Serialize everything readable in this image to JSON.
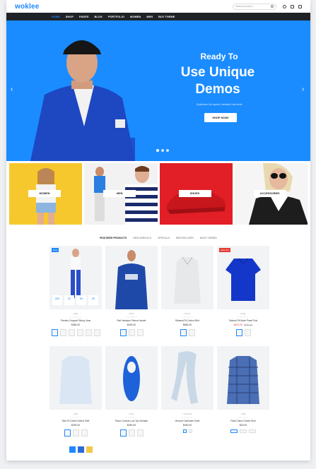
{
  "header": {
    "logo": "woklee",
    "search_placeholder": "Search product...",
    "icons": [
      "search-icon",
      "user-icon",
      "bag-icon",
      "compare-icon"
    ]
  },
  "nav": {
    "items": [
      "HOME",
      "SHOP",
      "PAGES",
      "BLOG",
      "PORTFOLIO",
      "WOMEN",
      "MEN",
      "BUY THEME"
    ]
  },
  "hero": {
    "line1": "Ready To",
    "line2": "Use Unique",
    "line3": "Demos",
    "subtitle": "Optimized for speed, website that sells",
    "button": "SHOP NOW!",
    "bg": "#1a8cff"
  },
  "categories": [
    {
      "label": "WOMEN",
      "bg": "#f7c82e"
    },
    {
      "label": "MEN",
      "bg": "#f2f2f2"
    },
    {
      "label": "SHOES",
      "bg": "#e21f26"
    },
    {
      "label": "ACCESSORIES",
      "bg": "#f5f5f5"
    }
  ],
  "tabs": [
    "FEATURED PRODUCTS",
    "NEW ARRIVALS",
    "SPECIALS",
    "BESTSELLERS",
    "MOST VIEWED"
  ],
  "products_row1": [
    {
      "badge": "New",
      "brand": "LIME",
      "name": "Premier Cropped Skinny Jean",
      "price": "$380.00",
      "countdown": [
        "282",
        "22",
        "59",
        "39"
      ]
    },
    {
      "badge": "",
      "brand": "DNKI",
      "name": "Earl Hampton Fleece Hoodie",
      "price": "$490.00"
    },
    {
      "badge": "",
      "brand": "AXIOS",
      "name": "Relaxed Fit Cotton Shirt",
      "price": "$680.00"
    },
    {
      "badge": "Sold Out",
      "brand": "DIMM",
      "name": "Tailored Fit Mesh Panel Polo",
      "price_new": "$470.00",
      "price_old": "$660.00"
    }
  ],
  "products_row2": [
    {
      "brand": "LIME",
      "name": "Slim Fit Cotton Oxford Shirt",
      "price": "$290.00"
    },
    {
      "brand": "DNKI",
      "name": "Paxon Canvas Low-Top Sneaker",
      "price": "$490.00"
    },
    {
      "brand": "LACOSTE",
      "name": "Viscose Cashmere Scarf",
      "price": "$490.00"
    },
    {
      "brand": "LIME",
      "name": "Plaid Cotton Oxford Shirt",
      "price": "$20.00"
    }
  ],
  "colors": {
    "accent": "#1e88ff",
    "nav_bg": "#1f2327",
    "sale": "#e53935"
  }
}
